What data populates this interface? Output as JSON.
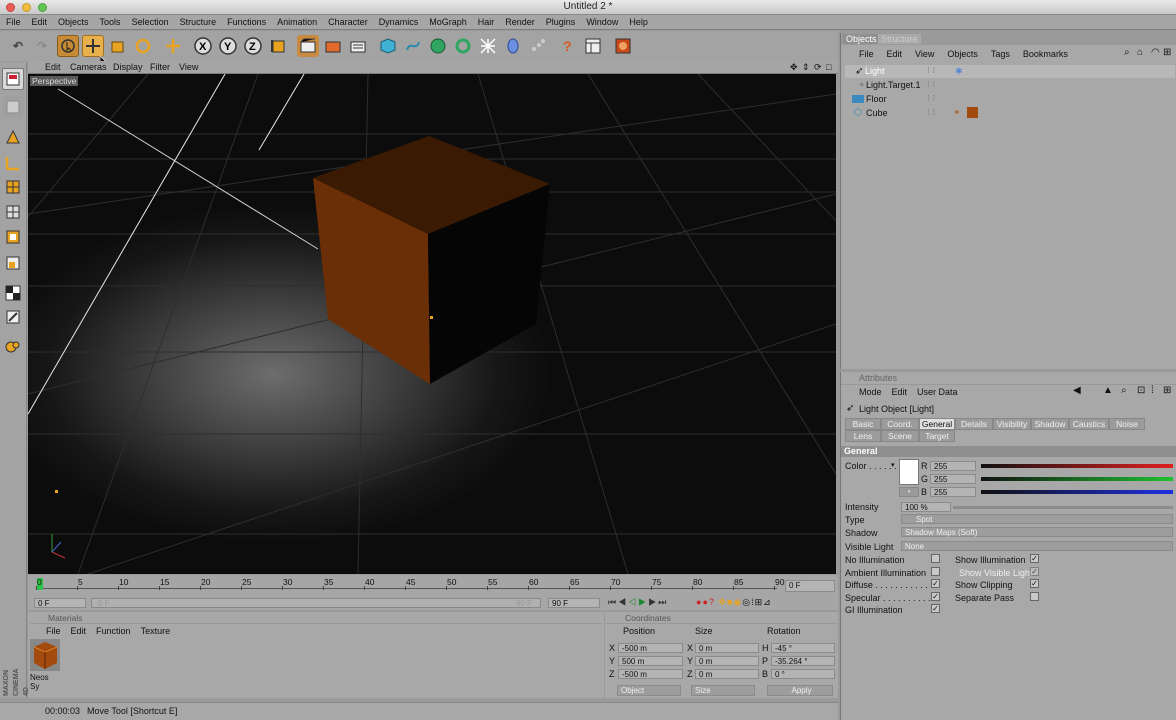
{
  "window": {
    "title": "Untitled 2 *"
  },
  "menu": [
    "File",
    "Edit",
    "Objects",
    "Tools",
    "Selection",
    "Structure",
    "Functions",
    "Animation",
    "Character",
    "Dynamics",
    "MoGraph",
    "Hair",
    "Render",
    "Plugins",
    "Window",
    "Help"
  ],
  "viewport": {
    "menu": [
      "Edit",
      "Cameras",
      "Display",
      "Filter",
      "View"
    ],
    "camera_label": "Perspective"
  },
  "timeline": {
    "ticks": [
      "0",
      "5",
      "10",
      "15",
      "20",
      "25",
      "30",
      "35",
      "40",
      "45",
      "50",
      "55",
      "60",
      "65",
      "70",
      "75",
      "80",
      "85",
      "90"
    ],
    "current_frame": "0 F",
    "start_field": "0 F",
    "start_slider": "0 F",
    "end_slider": "90 F",
    "end_field": "90 F"
  },
  "materials": {
    "title": "Materials",
    "menu": [
      "File",
      "Edit",
      "Function",
      "Texture"
    ],
    "items": [
      {
        "label": "Neos Sy"
      }
    ]
  },
  "coordinates": {
    "title": "Coordinates",
    "headers": [
      "Position",
      "Size",
      "Rotation"
    ],
    "rows": [
      {
        "axis": "X",
        "pos": "-500 m",
        "saxis": "X",
        "size": "0 m",
        "raxis": "H",
        "rot": "-45 °"
      },
      {
        "axis": "Y",
        "pos": "500 m",
        "saxis": "Y",
        "size": "0 m",
        "raxis": "P",
        "rot": "-35.264 °"
      },
      {
        "axis": "Z",
        "pos": "-500 m",
        "saxis": "Z",
        "size": "0 m",
        "raxis": "B",
        "rot": "0 °"
      }
    ],
    "mode_select": "Object",
    "size_select": "Size",
    "apply": "Apply"
  },
  "status": {
    "time": "00:00:03",
    "message": "Move Tool [Shortcut E]"
  },
  "logo": {
    "line1": "MAXON",
    "line2": "CINEMA 4D"
  },
  "objects": {
    "tabs": [
      "Objects",
      "Structure"
    ],
    "menu": [
      "File",
      "Edit",
      "View",
      "Objects",
      "Tags",
      "Bookmarks"
    ],
    "items": [
      {
        "name": "Light",
        "icon": "spot-light-icon"
      },
      {
        "name": "Light.Target.1",
        "icon": "null-object-icon"
      },
      {
        "name": "Floor",
        "icon": "floor-icon"
      },
      {
        "name": "Cube",
        "icon": "cube-icon"
      }
    ]
  },
  "attributes": {
    "title": "Attributes",
    "menu": [
      "Mode",
      "Edit",
      "User Data"
    ],
    "object": "Light Object [Light]",
    "tabs_row1": [
      "Basic",
      "Coord.",
      "General",
      "Details",
      "Visibility",
      "Shadow",
      "Caustics",
      "Noise"
    ],
    "tabs_row2": [
      "Lens",
      "Scene",
      "Target"
    ],
    "active_tab": "General",
    "section": "General",
    "color_label": "Color . . . . . .",
    "rgb": [
      {
        "ch": "R",
        "val": "255"
      },
      {
        "ch": "G",
        "val": "255"
      },
      {
        "ch": "B",
        "val": "255"
      }
    ],
    "intensity_label": "Intensity",
    "intensity": "100 %",
    "type_label": "Type",
    "type": "Spot",
    "shadow_label": "Shadow",
    "shadow": "Shadow Maps (Soft)",
    "visible_light_label": "Visible Light",
    "visible_light": "None",
    "checks_left": [
      {
        "label": "No Illumination",
        "checked": false
      },
      {
        "label": "Ambient Illumination",
        "checked": false
      },
      {
        "label": "Diffuse . . . . . . . . . . .",
        "checked": true
      },
      {
        "label": "Specular . . . . . . . . . .",
        "checked": true
      },
      {
        "label": "GI Illumination",
        "checked": true
      }
    ],
    "checks_right": [
      {
        "label": "Show Illumination",
        "checked": true
      },
      {
        "label": "Show Visible Light",
        "checked": true
      },
      {
        "label": "Show Clipping",
        "checked": true
      },
      {
        "label": "Separate Pass",
        "checked": false
      }
    ]
  },
  "colors": {
    "accent_orange": "#e38a1c",
    "cube_face": "#6b2f07",
    "selected_tab": "#e0e0e0"
  }
}
